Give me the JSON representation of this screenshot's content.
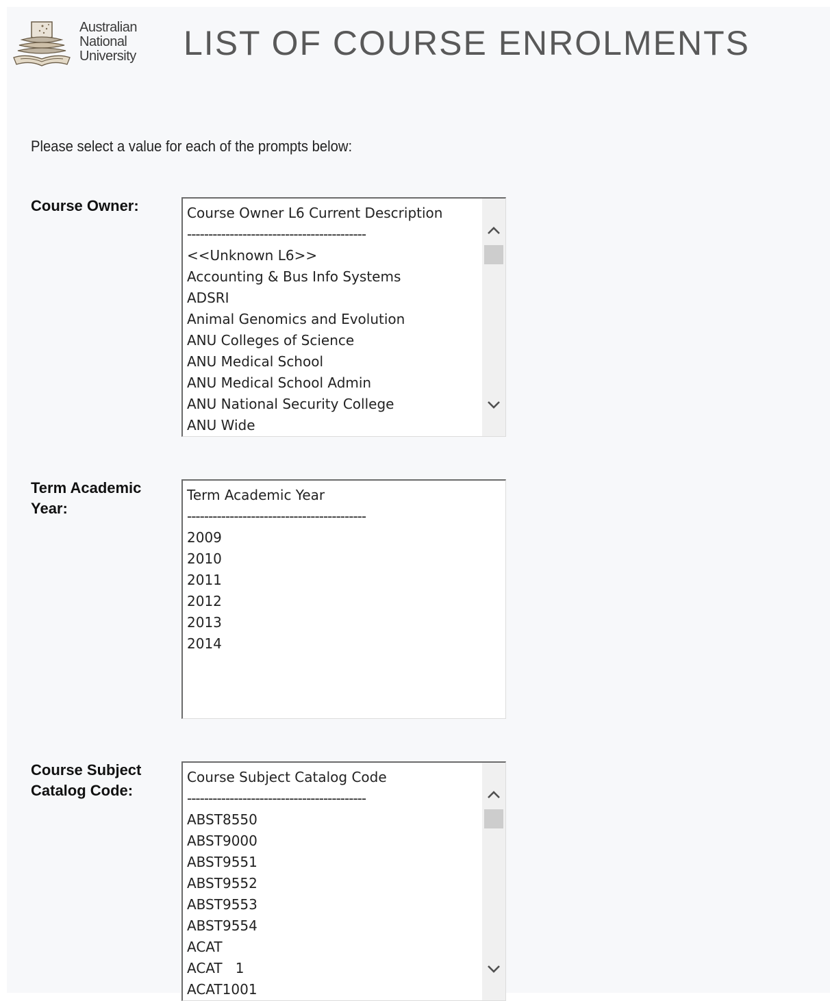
{
  "header": {
    "logo_lines": [
      "Australian",
      "National",
      "University"
    ],
    "title": "LIST OF COURSE ENROLMENTS"
  },
  "instructions": "Please select a value for each of the prompts below:",
  "prompts": [
    {
      "label": "Course Owner:",
      "header": "Course Owner L6 Current Description",
      "divider": "------------------------------------------",
      "options": [
        "<<Unknown L6>>",
        "Accounting & Bus Info Systems",
        "ADSRI",
        "Animal Genomics and Evolution",
        "ANU Colleges of Science",
        "ANU Medical School",
        "ANU Medical School Admin",
        "ANU National Security College",
        "ANU Wide"
      ],
      "scrollable": true
    },
    {
      "label": "Term Academic Year:",
      "header": "Term Academic Year",
      "divider": "------------------------------------------",
      "options": [
        "2009",
        "2010",
        "2011",
        "2012",
        "2013",
        "2014"
      ],
      "scrollable": false
    },
    {
      "label": "Course Subject Catalog Code:",
      "header": "Course Subject Catalog Code",
      "divider": "------------------------------------------",
      "options": [
        "ABST8550",
        "ABST9000",
        "ABST9551",
        "ABST9552",
        "ABST9553",
        "ABST9554",
        "ACAT",
        "ACAT   1",
        "ACAT1001"
      ],
      "scrollable": true
    }
  ],
  "icons": {
    "scroll_up": "chevron-up-icon",
    "scroll_down": "chevron-down-icon",
    "logo": "anu-crest-icon"
  }
}
